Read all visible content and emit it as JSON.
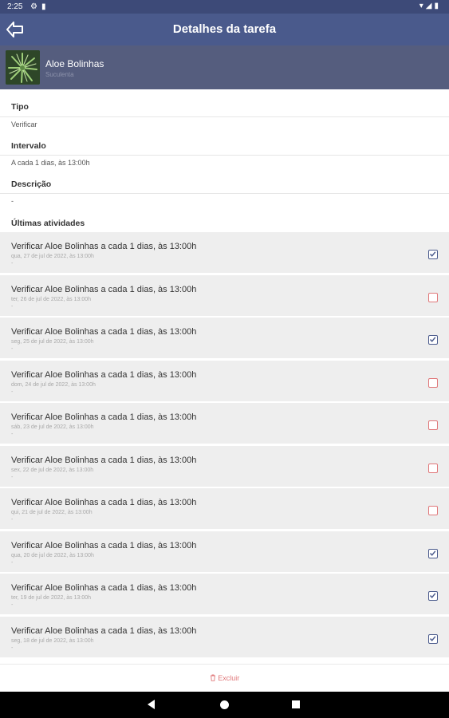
{
  "status_bar": {
    "time": "2:25",
    "left_icons": [
      "gear-icon",
      "sd-card-icon"
    ],
    "right_icons": [
      "wifi-icon",
      "signal-icon",
      "battery-icon"
    ]
  },
  "app_bar": {
    "title": "Detalhes da tarefa",
    "back_icon": "back-arrow-icon",
    "color": "#4a5a8c"
  },
  "plant": {
    "name": "Aloe Bolinhas",
    "type": "Suculenta"
  },
  "details": {
    "tipo_label": "Tipo",
    "tipo_value": "Verificar",
    "intervalo_label": "Intervalo",
    "intervalo_value": "A cada 1 dias, às 13:00h",
    "descricao_label": "Descrição",
    "descricao_value": "-",
    "atividades_label": "Últimas atividades"
  },
  "activities": [
    {
      "title": "Verificar Aloe Bolinhas a cada 1 dias, às 13:00h",
      "date": "qua, 27 de jul de 2022, às 13:00h",
      "note": "-",
      "done": true
    },
    {
      "title": "Verificar Aloe Bolinhas a cada 1 dias, às 13:00h",
      "date": "ter, 26 de jul de 2022, às 13:00h",
      "note": "-",
      "done": false
    },
    {
      "title": "Verificar Aloe Bolinhas a cada 1 dias, às 13:00h",
      "date": "seg, 25 de jul de 2022, às 13:00h",
      "note": "-",
      "done": true
    },
    {
      "title": "Verificar Aloe Bolinhas a cada 1 dias, às 13:00h",
      "date": "dom, 24 de jul de 2022, às 13:00h",
      "note": "-",
      "done": false
    },
    {
      "title": "Verificar Aloe Bolinhas a cada 1 dias, às 13:00h",
      "date": "sáb, 23 de jul de 2022, às 13:00h",
      "note": "-",
      "done": false
    },
    {
      "title": "Verificar Aloe Bolinhas a cada 1 dias, às 13:00h",
      "date": "sex, 22 de jul de 2022, às 13:00h",
      "note": "-",
      "done": false
    },
    {
      "title": "Verificar Aloe Bolinhas a cada 1 dias, às 13:00h",
      "date": "qui, 21 de jul de 2022, às 13:00h",
      "note": "-",
      "done": false
    },
    {
      "title": "Verificar Aloe Bolinhas a cada 1 dias, às 13:00h",
      "date": "qua, 20 de jul de 2022, às 13:00h",
      "note": "-",
      "done": true
    },
    {
      "title": "Verificar Aloe Bolinhas a cada 1 dias, às 13:00h",
      "date": "ter, 19 de jul de 2022, às 13:00h",
      "note": "-",
      "done": true
    },
    {
      "title": "Verificar Aloe Bolinhas a cada 1 dias, às 13:00h",
      "date": "seg, 18 de jul de 2022, às 13:00h",
      "note": "-",
      "done": true
    }
  ],
  "footer": {
    "delete_label": "Excluir",
    "delete_icon": "trash-icon",
    "delete_color": "#e0787a"
  },
  "nav_bar": {
    "buttons": [
      "nav-back-icon",
      "nav-home-icon",
      "nav-recents-icon"
    ]
  }
}
